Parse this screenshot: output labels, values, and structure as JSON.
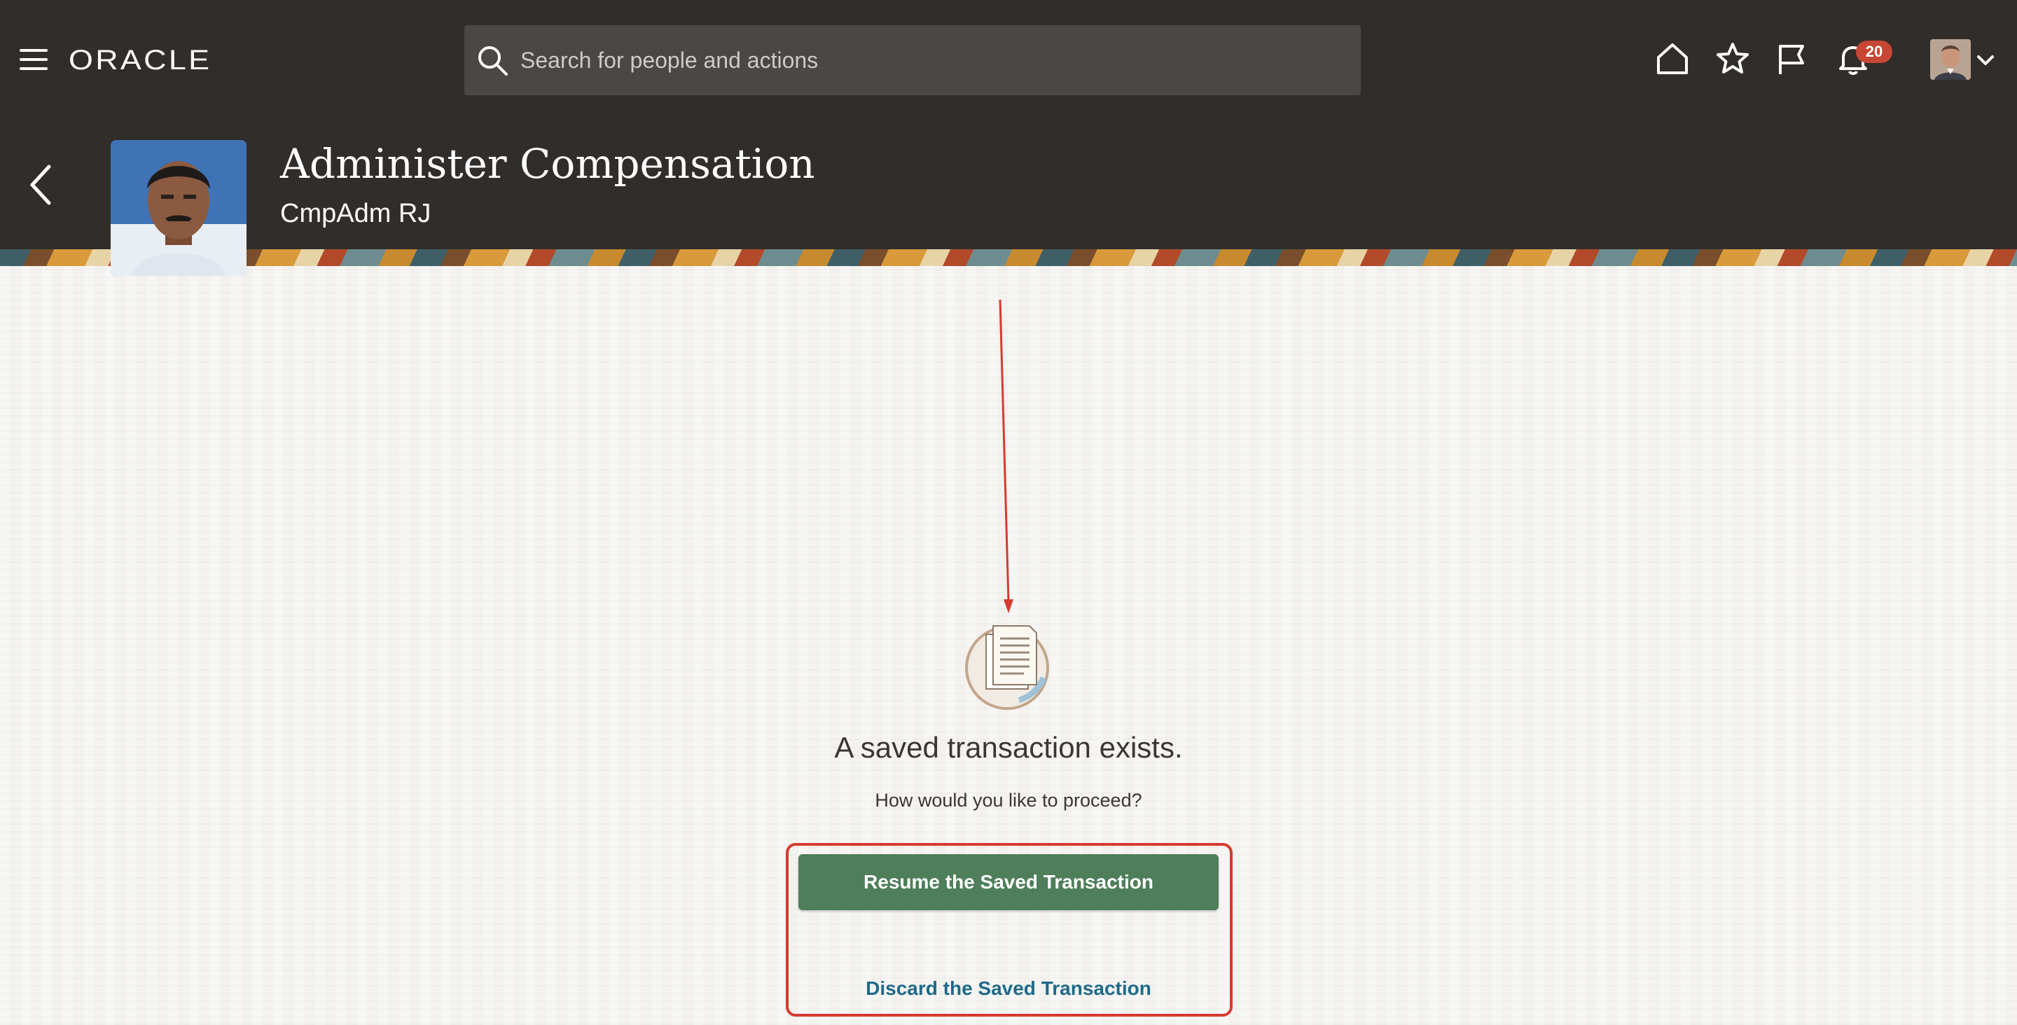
{
  "topbar": {
    "logo": "ORACLE",
    "search": {
      "placeholder": "Search for people and actions",
      "value": ""
    },
    "notifications_count": "20",
    "icons": [
      "menu-icon",
      "search-icon",
      "home-icon",
      "star-icon",
      "flag-icon",
      "bell-icon",
      "avatar",
      "chevron-down-icon"
    ]
  },
  "header": {
    "title": "Administer Compensation",
    "subtitle": "CmpAdm RJ"
  },
  "main": {
    "icon": "document-icon",
    "message_title": "A saved transaction exists.",
    "message_sub": "How would you like to proceed?",
    "resume_label": "Resume the Saved Transaction",
    "discard_label": "Discard the Saved Transaction"
  },
  "colors": {
    "topbar_bg": "#312d2a",
    "primary_button": "#4f7e5a",
    "link": "#1f6a8a",
    "annotation": "#d63b2f",
    "badge": "#c74634"
  }
}
